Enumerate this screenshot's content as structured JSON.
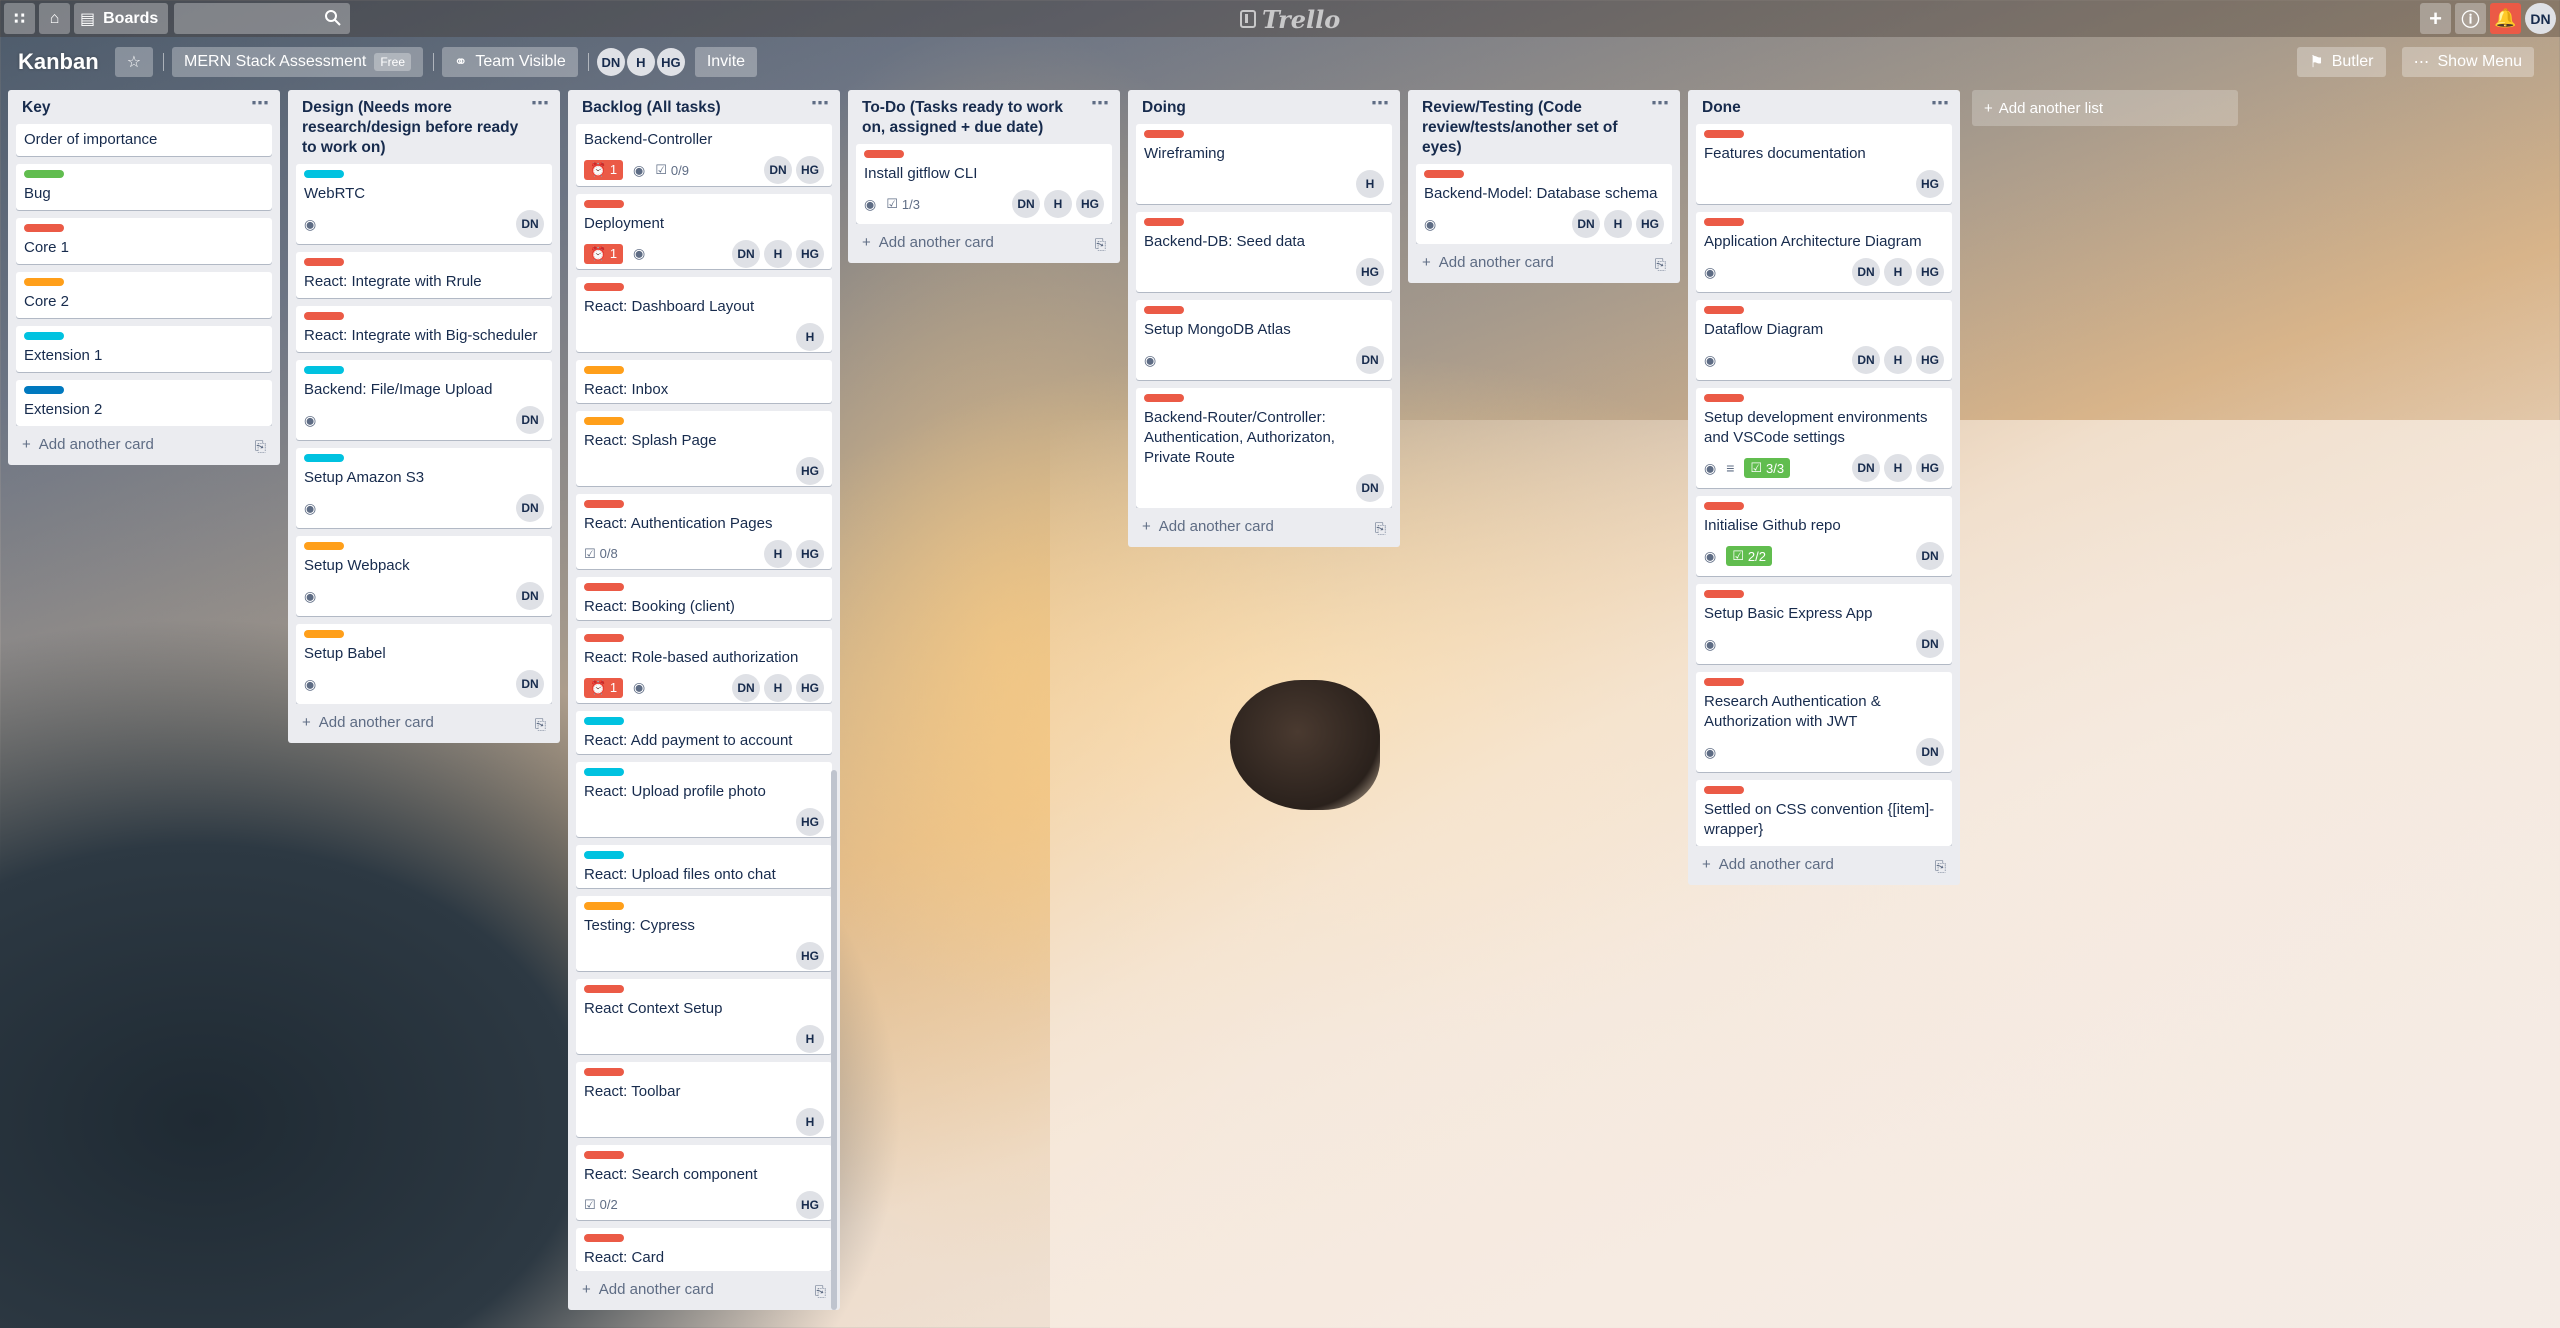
{
  "topbar": {
    "boards_label": "Boards",
    "logo_text": "Trello",
    "avatar": "DN"
  },
  "board": {
    "title": "Kanban",
    "name_btn": "MERN Stack Assessment",
    "free_badge": "Free",
    "visibility": "Team Visible",
    "members": [
      "DN",
      "H",
      "HG"
    ],
    "invite": "Invite",
    "butler": "Butler",
    "show_menu": "Show Menu"
  },
  "add_card_label": "Add another card",
  "add_list_label": "Add another list",
  "colors": {
    "green": "#61bd4f",
    "red": "#eb5a46",
    "orange": "#ff9f1a",
    "sky": "#00c2e0",
    "blue": "#0079bf"
  },
  "lists": [
    {
      "title": "Key",
      "cards": [
        {
          "title": "Order of importance"
        },
        {
          "label": "green",
          "title": "Bug"
        },
        {
          "label": "red",
          "title": "Core 1"
        },
        {
          "label": "orange",
          "title": "Core 2"
        },
        {
          "label": "sky",
          "title": "Extension 1"
        },
        {
          "label": "blue",
          "title": "Extension 2"
        }
      ]
    },
    {
      "title": "Design (Needs more research/design before ready to work on)",
      "cards": [
        {
          "label": "sky",
          "title": "WebRTC",
          "watch": true,
          "members": [
            "DN"
          ]
        },
        {
          "label": "red",
          "title": "React: Integrate with Rrule"
        },
        {
          "label": "red",
          "title": "React: Integrate with Big-scheduler"
        },
        {
          "label": "sky",
          "title": "Backend: File/Image Upload",
          "watch": true,
          "members": [
            "DN"
          ]
        },
        {
          "label": "sky",
          "title": "Setup Amazon S3",
          "watch": true,
          "members": [
            "DN"
          ]
        },
        {
          "label": "orange",
          "title": "Setup Webpack",
          "watch": true,
          "members": [
            "DN"
          ]
        },
        {
          "label": "orange",
          "title": "Setup Babel",
          "watch": true,
          "members": [
            "DN"
          ]
        }
      ]
    },
    {
      "title": "Backlog (All tasks)",
      "scroll": true,
      "cards": [
        {
          "title": "Backend-Controller",
          "alert": "1",
          "watch": true,
          "check": "0/9",
          "members": [
            "DN",
            "HG"
          ]
        },
        {
          "label": "red",
          "title": "Deployment",
          "alert": "1",
          "watch": true,
          "members": [
            "DN",
            "H",
            "HG"
          ]
        },
        {
          "label": "red",
          "title": "React: Dashboard Layout",
          "members": [
            "H"
          ]
        },
        {
          "label": "orange",
          "title": "React: Inbox"
        },
        {
          "label": "orange",
          "title": "React: Splash Page",
          "members": [
            "HG"
          ]
        },
        {
          "label": "red",
          "title": "React: Authentication Pages",
          "check": "0/8",
          "members": [
            "H",
            "HG"
          ]
        },
        {
          "label": "red",
          "title": "React: Booking (client)"
        },
        {
          "label": "red",
          "title": "React: Role-based authorization",
          "alert": "1",
          "watch": true,
          "members": [
            "DN",
            "H",
            "HG"
          ]
        },
        {
          "label": "sky",
          "title": "React: Add payment to account"
        },
        {
          "label": "sky",
          "title": "React: Upload profile photo",
          "members": [
            "HG"
          ]
        },
        {
          "label": "sky",
          "title": "React: Upload files onto chat"
        },
        {
          "label": "orange",
          "title": "Testing: Cypress",
          "members": [
            "HG"
          ]
        },
        {
          "label": "red",
          "title": "React Context Setup",
          "members": [
            "H"
          ]
        },
        {
          "label": "red",
          "title": "React: Toolbar",
          "members": [
            "H"
          ]
        },
        {
          "label": "red",
          "title": "React: Search component",
          "check": "0/2",
          "members": [
            "HG"
          ]
        },
        {
          "label": "red",
          "title": "React: Card"
        }
      ]
    },
    {
      "title": "To-Do (Tasks ready to work on, assigned + due date)",
      "cards": [
        {
          "label": "red",
          "title": "Install gitflow CLI",
          "watch": true,
          "check": "1/3",
          "members": [
            "DN",
            "H",
            "HG"
          ]
        }
      ]
    },
    {
      "title": "Doing",
      "cards": [
        {
          "label": "red",
          "title": "Wireframing",
          "members": [
            "H"
          ]
        },
        {
          "label": "red",
          "title": "Backend-DB: Seed data",
          "members": [
            "HG"
          ]
        },
        {
          "label": "red",
          "title": "Setup MongoDB Atlas",
          "watch": true,
          "members": [
            "DN"
          ]
        },
        {
          "label": "red",
          "title": "Backend-Router/Controller: Authentication, Authorizaton, Private Route",
          "members": [
            "DN"
          ]
        }
      ]
    },
    {
      "title": "Review/Testing (Code review/tests/another set of eyes)",
      "cards": [
        {
          "label": "red",
          "title": "Backend-Model: Database schema",
          "watch": true,
          "members": [
            "DN",
            "H",
            "HG"
          ]
        }
      ]
    },
    {
      "title": "Done",
      "cards": [
        {
          "label": "red",
          "title": "Features documentation",
          "members": [
            "HG"
          ]
        },
        {
          "label": "red",
          "title": "Application Architecture Diagram",
          "watch": true,
          "members": [
            "DN",
            "H",
            "HG"
          ]
        },
        {
          "label": "red",
          "title": "Dataflow Diagram",
          "watch": true,
          "members": [
            "DN",
            "H",
            "HG"
          ]
        },
        {
          "label": "red",
          "title": "Setup development environments and VSCode settings",
          "watch": true,
          "desc": true,
          "check": "3/3",
          "check_done": true,
          "members": [
            "DN",
            "H",
            "HG"
          ]
        },
        {
          "label": "red",
          "title": "Initialise Github repo",
          "watch": true,
          "check": "2/2",
          "check_done": true,
          "members": [
            "DN"
          ]
        },
        {
          "label": "red",
          "title": "Setup Basic Express App",
          "watch": true,
          "members": [
            "DN"
          ]
        },
        {
          "label": "red",
          "title": "Research Authentication & Authorization with JWT",
          "watch": true,
          "members": [
            "DN"
          ]
        },
        {
          "label": "red",
          "title": "Settled on CSS convention {[item]-wrapper}"
        }
      ]
    }
  ]
}
